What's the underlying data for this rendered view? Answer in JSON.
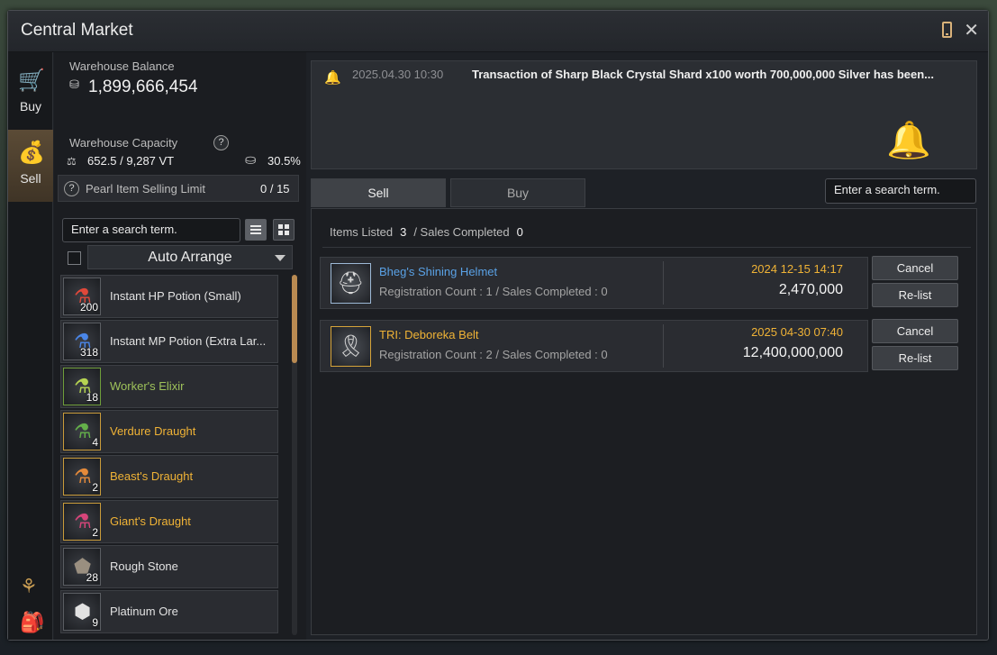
{
  "window": {
    "title": "Central Market"
  },
  "rail": {
    "buy_label": "Buy",
    "sell_label": "Sell"
  },
  "warehouse": {
    "balance_label": "Warehouse Balance",
    "balance_value": "1,899,666,454",
    "capacity_label": "Warehouse Capacity",
    "capacity_value": "652.5 / 9,287 VT",
    "capacity_percent": "30.5%"
  },
  "pearl": {
    "label": "Pearl Item Selling Limit",
    "value": "0 / 15"
  },
  "left_search": {
    "placeholder": "Enter a search term."
  },
  "arrange": {
    "label": "Auto Arrange"
  },
  "inventory": [
    {
      "name": "Instant HP Potion (Small)",
      "qty": "200",
      "grade": "white",
      "icon": "red-potion-icon"
    },
    {
      "name": "Instant MP Potion (Extra Lar...",
      "qty": "318",
      "grade": "white",
      "icon": "blue-potion-icon"
    },
    {
      "name": "Worker's Elixir",
      "qty": "18",
      "grade": "green",
      "icon": "elixir-icon"
    },
    {
      "name": "Verdure Draught",
      "qty": "4",
      "grade": "gold",
      "icon": "green-draught-icon"
    },
    {
      "name": "Beast's Draught",
      "qty": "2",
      "grade": "gold",
      "icon": "orange-draught-icon"
    },
    {
      "name": "Giant's Draught",
      "qty": "2",
      "grade": "gold",
      "icon": "pink-draught-icon"
    },
    {
      "name": "Rough Stone",
      "qty": "28",
      "grade": "white",
      "icon": "stone-icon"
    },
    {
      "name": "Platinum Ore",
      "qty": "9",
      "grade": "white",
      "icon": "ore-icon"
    }
  ],
  "notice": {
    "time": "2025.04.30 10:30",
    "text": "Transaction of Sharp Black Crystal Shard x100 worth 700,000,000 Silver has been..."
  },
  "tabs": {
    "sell": "Sell",
    "buy": "Buy"
  },
  "right_search": {
    "placeholder": "Enter a search term."
  },
  "sales": {
    "items_listed_label": "Items Listed",
    "items_listed": "3",
    "sales_completed_label": "/ Sales Completed",
    "sales_completed": "0",
    "listings": [
      {
        "name": "Bheg's Shining Helmet",
        "grade": "blue",
        "registration": "Registration Count : 1 / Sales Completed : 0",
        "date": "2024 12-15 14:17",
        "price": "2,470,000",
        "cancel": "Cancel",
        "relist": "Re-list"
      },
      {
        "name": "TRI: Deboreka Belt",
        "grade": "gold",
        "registration": "Registration Count : 2 / Sales Completed : 0",
        "date": "2025 04-30 07:40",
        "price": "12,400,000,000",
        "cancel": "Cancel",
        "relist": "Re-list"
      }
    ]
  },
  "colors": {
    "gold": "#f0b336",
    "blue": "#5aa2e6",
    "green": "#9ec25a",
    "accent": "#b98a52"
  }
}
